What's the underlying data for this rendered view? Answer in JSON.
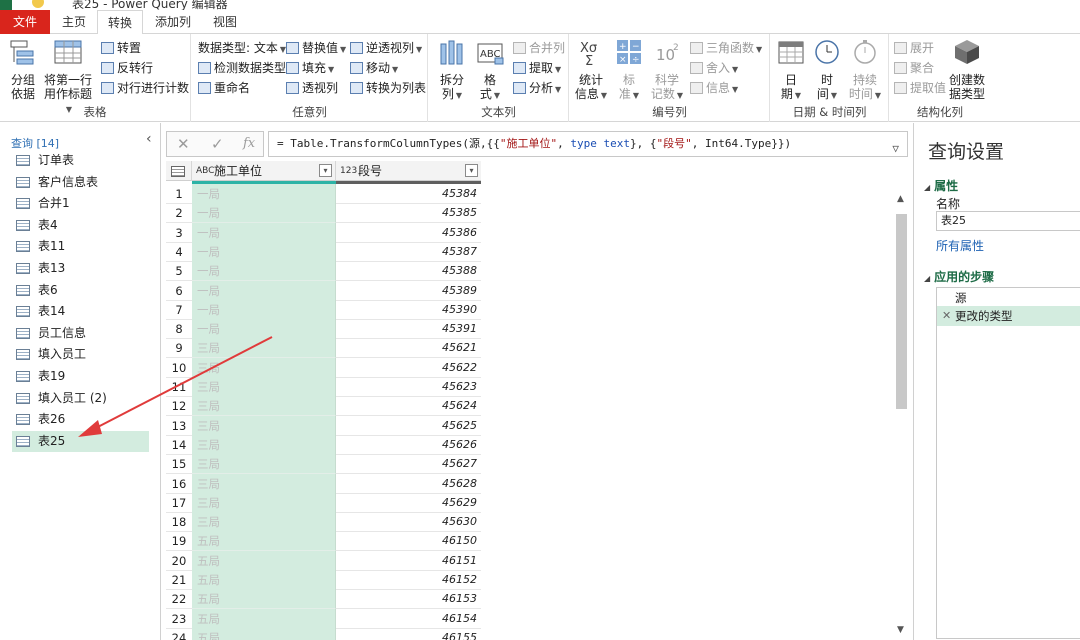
{
  "window": {
    "title": "表25 - Power Query 编辑器"
  },
  "tabs": [
    "文件",
    "主页",
    "转换",
    "添加列",
    "视图"
  ],
  "ribbon": {
    "table_group": {
      "label": "表格",
      "group_by": "分组\n依据",
      "first_row_header_1": "将第一行",
      "first_row_header_2": "用作标题",
      "transpose": "转置",
      "reverse_rows": "反转行",
      "count_rows": "对行进行计数"
    },
    "anycol_group": {
      "label": "任意列",
      "data_type": "数据类型: 文本",
      "detect_type": "检测数据类型",
      "rename": "重命名",
      "replace_values": "替换值",
      "fill": "填充",
      "pivot": "透视列",
      "unpivot": "逆透视列",
      "move": "移动",
      "to_list": "转换为列表"
    },
    "textcol_group": {
      "label": "文本列",
      "split_1": "拆分",
      "split_2": "列",
      "format_1": "格",
      "format_2": "式",
      "merge": "合并列",
      "extract": "提取",
      "parse": "分析"
    },
    "numcol_group": {
      "label": "编号列",
      "stats_1": "统计",
      "stats_2": "信息",
      "std_1": "标",
      "std_2": "准",
      "sci_1": "科学",
      "sci_2": "记数",
      "trig": "三角函数",
      "round": "舍入",
      "info": "信息"
    },
    "datetime_group": {
      "label": "日期 & 时间列",
      "date_1": "日",
      "date_2": "期",
      "time_1": "时",
      "time_2": "间",
      "dur_1": "持续",
      "dur_2": "时间"
    },
    "struct_group": {
      "label": "结构化列",
      "expand": "展开",
      "aggregate": "聚合",
      "extract_values": "提取值",
      "create_type_1": "创建数",
      "create_type_2": "据类型"
    }
  },
  "queries": {
    "header": "查询 [14]",
    "items": [
      "订单表",
      "客户信息表",
      "合并1",
      "表4",
      "表11",
      "表13",
      "表6",
      "表14",
      "员工信息",
      "填入员工",
      "表19",
      "填入员工 (2)",
      "表26",
      "表25"
    ],
    "selected_index": 13
  },
  "formula": {
    "prefix": "= Table.TransformColumnTypes(源,{{",
    "s1": "\"施工单位\"",
    "c1": ", ",
    "kw1": "type text",
    "c2": "}, {",
    "s2": "\"段号\"",
    "c3": ", Int64.Type}})"
  },
  "grid": {
    "columns": [
      {
        "type_icon": "ABC",
        "name": "施工单位"
      },
      {
        "type_icon": "123",
        "name": "段号"
      }
    ],
    "rows": [
      {
        "n": "1",
        "unit": "一局",
        "seg": "45384"
      },
      {
        "n": "2",
        "unit": "一局",
        "seg": "45385"
      },
      {
        "n": "3",
        "unit": "一局",
        "seg": "45386"
      },
      {
        "n": "4",
        "unit": "一局",
        "seg": "45387"
      },
      {
        "n": "5",
        "unit": "一局",
        "seg": "45388"
      },
      {
        "n": "6",
        "unit": "一局",
        "seg": "45389"
      },
      {
        "n": "7",
        "unit": "一局",
        "seg": "45390"
      },
      {
        "n": "8",
        "unit": "一局",
        "seg": "45391"
      },
      {
        "n": "9",
        "unit": "三局",
        "seg": "45621"
      },
      {
        "n": "10",
        "unit": "三局",
        "seg": "45622"
      },
      {
        "n": "11",
        "unit": "三局",
        "seg": "45623"
      },
      {
        "n": "12",
        "unit": "三局",
        "seg": "45624"
      },
      {
        "n": "13",
        "unit": "三局",
        "seg": "45625"
      },
      {
        "n": "14",
        "unit": "三局",
        "seg": "45626"
      },
      {
        "n": "15",
        "unit": "三局",
        "seg": "45627"
      },
      {
        "n": "16",
        "unit": "三局",
        "seg": "45628"
      },
      {
        "n": "17",
        "unit": "三局",
        "seg": "45629"
      },
      {
        "n": "18",
        "unit": "三局",
        "seg": "45630"
      },
      {
        "n": "19",
        "unit": "五局",
        "seg": "46150"
      },
      {
        "n": "20",
        "unit": "五局",
        "seg": "46151"
      },
      {
        "n": "21",
        "unit": "五局",
        "seg": "46152"
      },
      {
        "n": "22",
        "unit": "五局",
        "seg": "46153"
      },
      {
        "n": "23",
        "unit": "五局",
        "seg": "46154"
      },
      {
        "n": "24",
        "unit": "五局",
        "seg": "46155"
      }
    ]
  },
  "settings": {
    "title": "查询设置",
    "props_header": "属性",
    "name_label": "名称",
    "name_value": "表25",
    "all_props": "所有属性",
    "steps_header": "应用的步骤",
    "steps": [
      "源",
      "更改的类型"
    ],
    "selected_step": 1
  },
  "colors": {
    "file_tab": "#d9251c",
    "accent_green": "#1d6b46",
    "selection": "#d3ecdf",
    "annotation_arrow": "#e03b3b"
  }
}
